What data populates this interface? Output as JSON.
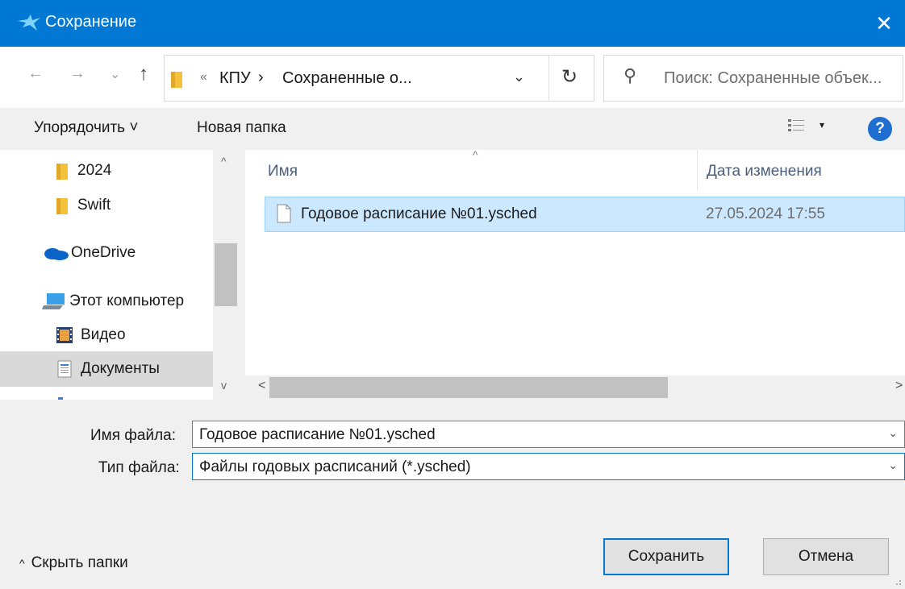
{
  "window": {
    "title": "Сохранение",
    "close_glyph": "✕",
    "icon": "bird-app-icon"
  },
  "nav": {
    "back": "←",
    "forward": "→",
    "recent": "⌄",
    "up": "↑",
    "path_overflow": "«",
    "breadcrumbs": [
      "КПУ",
      "Сохраненные о..."
    ],
    "crumb_sep": "›",
    "dropdown": "⌄",
    "refresh": "↻",
    "search_placeholder": "Поиск: Сохраненные объек..."
  },
  "toolbar": {
    "organize": "Упорядочить ˅",
    "new_folder": "Новая папка",
    "views_dd": "▾",
    "help": "?"
  },
  "navpane": {
    "items": [
      {
        "label": "2024",
        "icon": "folder-icon"
      },
      {
        "label": "Swift",
        "icon": "folder-icon"
      },
      {
        "label": "OneDrive",
        "icon": "onedrive-icon"
      },
      {
        "label": "Этот компьютер",
        "icon": "computer-icon"
      },
      {
        "label": "Видео",
        "icon": "video-icon"
      },
      {
        "label": "Документы",
        "icon": "documents-icon",
        "selected": true
      }
    ],
    "scroll_up": "^",
    "scroll_down": "v"
  },
  "filelist": {
    "sort_glyph": "^",
    "columns": {
      "name": "Имя",
      "date": "Дата изменения"
    },
    "rows": [
      {
        "name": "Годовое расписание №01.ysched",
        "date": "27.05.2024 17:55"
      }
    ],
    "scroll_left": "<",
    "scroll_right": ">"
  },
  "form": {
    "filename_label": "Имя файла:",
    "filename_value": "Годовое расписание №01.ysched",
    "filetype_label": "Тип файла:",
    "filetype_value": "Файлы годовых расписаний (*.ysched)",
    "dd_glyph": "⌄"
  },
  "footer": {
    "hide_folders": "Скрыть папки",
    "hide_caret": "^",
    "save": "Сохранить",
    "cancel": "Отмена"
  },
  "colors": {
    "titlebar": "#0078d4",
    "selection": "#cce8ff",
    "folder": "#f3c13a",
    "help": "#1f6fd1"
  }
}
